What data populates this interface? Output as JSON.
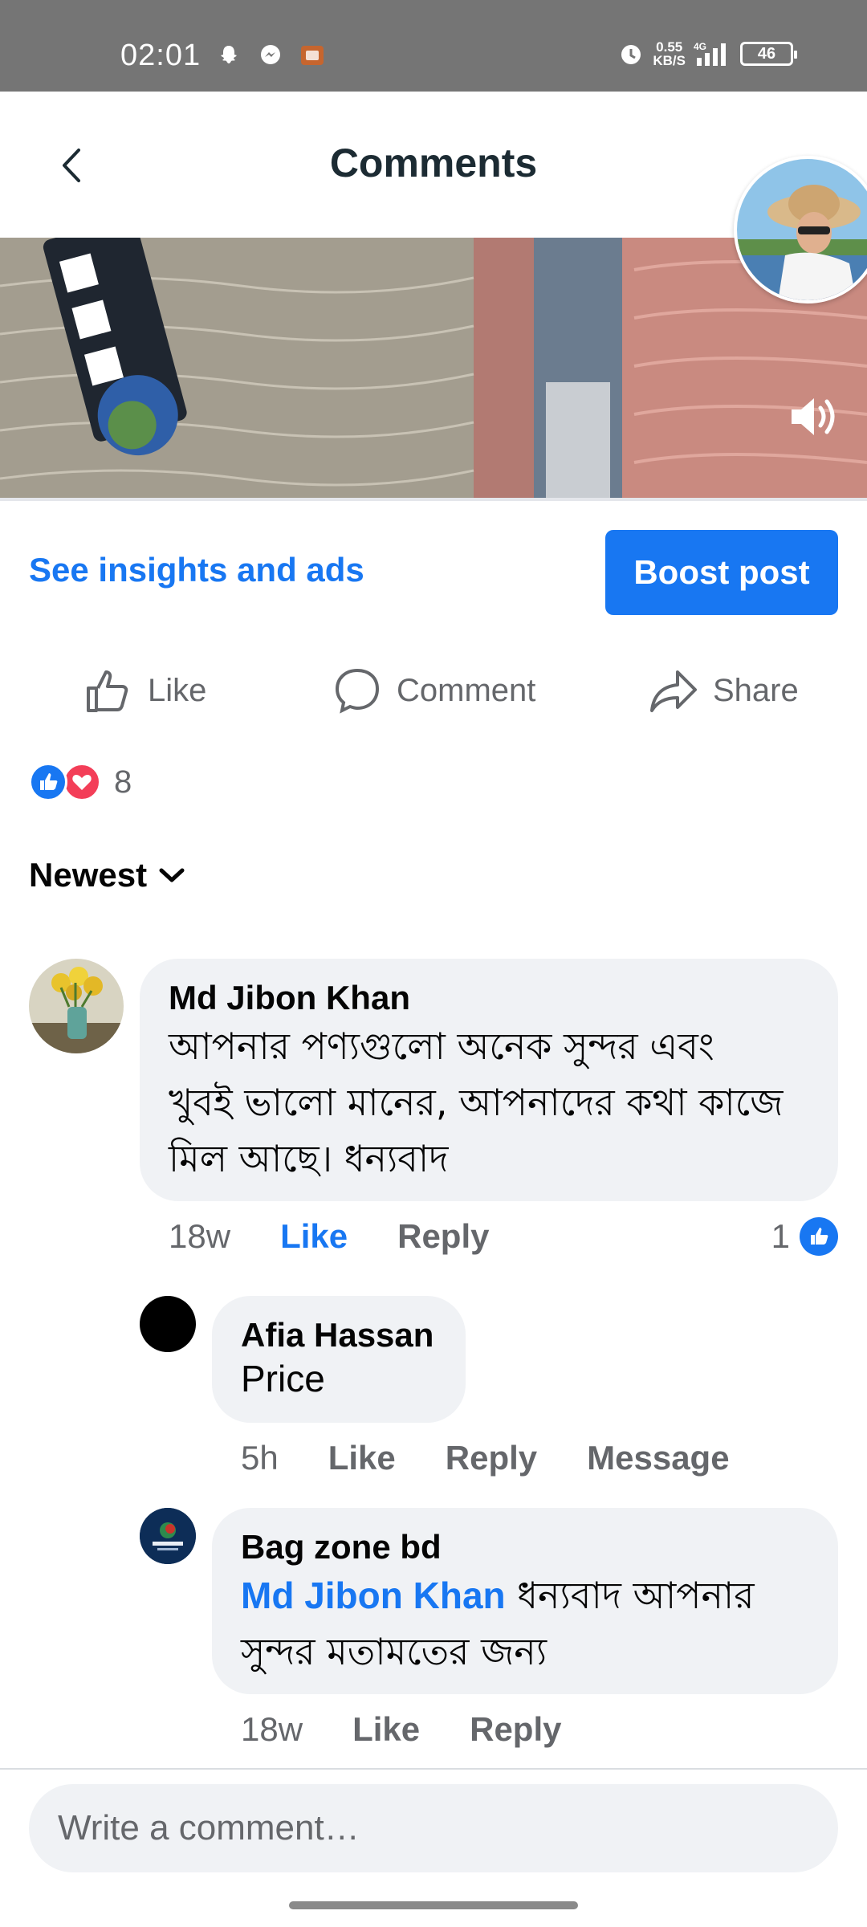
{
  "status_bar": {
    "time": "02:01",
    "net_speed_value": "0.55",
    "net_speed_unit": "KB/S",
    "network": "4G",
    "battery": "46",
    "icons": [
      "snapchat-icon",
      "messenger-icon",
      "app-icon",
      "alarm-icon",
      "signal-icon"
    ]
  },
  "header": {
    "title": "Comments"
  },
  "post_actions": {
    "insights_label": "See insights and ads",
    "boost_label": "Boost post",
    "like_label": "Like",
    "comment_label": "Comment",
    "share_label": "Share"
  },
  "reactions": {
    "count": "8"
  },
  "sort": {
    "label": "Newest"
  },
  "comments": [
    {
      "author": "Md Jibon Khan",
      "text": "আপনার পণ্যগুলো অনেক সুন্দর এবং খুবই ভালো মানের, আপনাদের কথা কাজে মিল আছে। ধন্যবাদ",
      "text_lines": [
        "আপনার পণ্যগুলো অনেক সুন্দর এবং",
        "খুবই ভালো মানের, আপনাদের কথা কাজে",
        "মিল আছে। ধন্যবাদ"
      ],
      "time": "18w",
      "like": "Like",
      "reply": "Reply",
      "like_count": "1"
    },
    {
      "author": "Afia Hassan",
      "text": "Price",
      "time": "5h",
      "like": "Like",
      "reply": "Reply",
      "message": "Message"
    },
    {
      "author": "Bag zone bd",
      "mention": "Md Jibon Khan",
      "text_line1": "ধন্যবাদ আপনার",
      "text_line2": "সুন্দর মতামতের জন্য",
      "time": "18w",
      "like": "Like",
      "reply": "Reply"
    }
  ],
  "composer": {
    "placeholder": "Write a comment…"
  },
  "colors": {
    "accent": "#1877f2",
    "bubble": "#f0f2f5",
    "muted_text": "#65676b",
    "status_bar": "#757575"
  }
}
